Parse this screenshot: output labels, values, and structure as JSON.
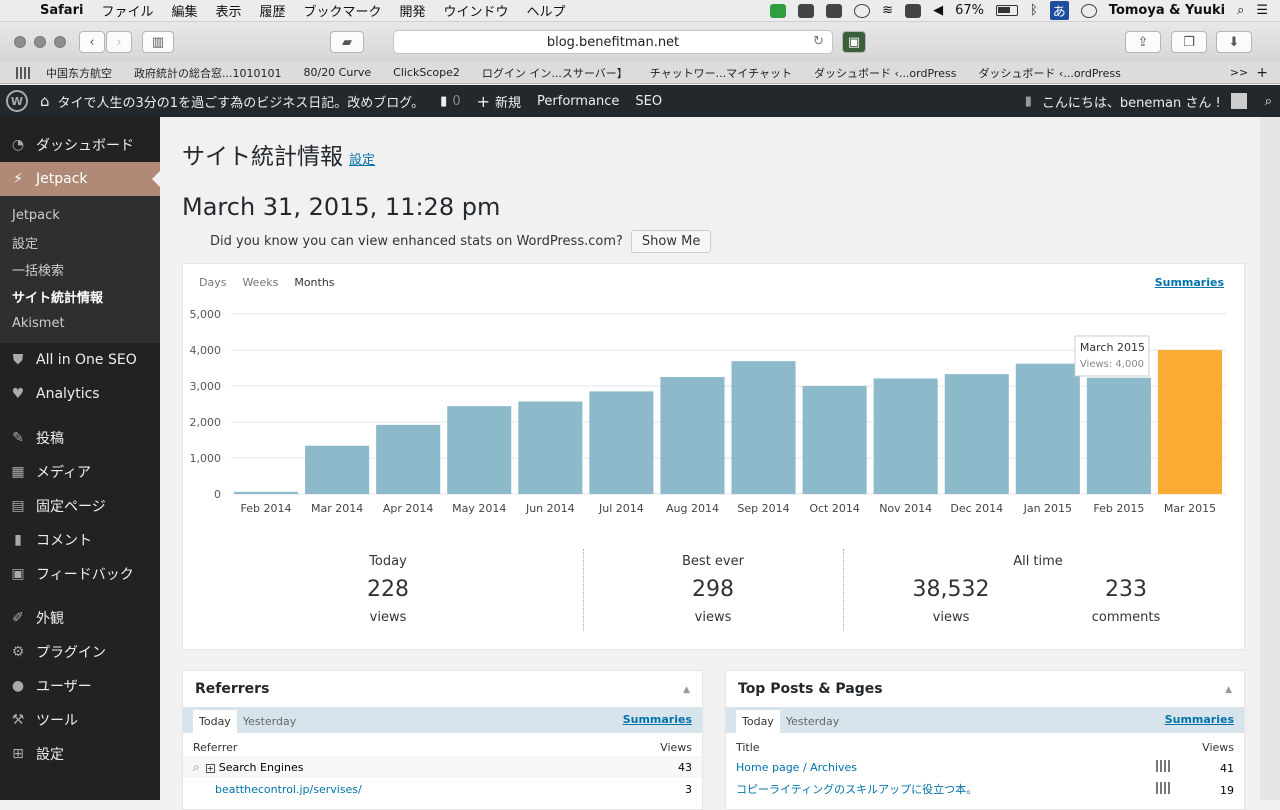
{
  "menubar": {
    "app": "Safari",
    "items": [
      "ファイル",
      "編集",
      "表示",
      "履歴",
      "ブックマーク",
      "開発",
      "ウインドウ",
      "ヘルプ"
    ],
    "battery": "67%",
    "input_method": "あ",
    "user": "Tomoya & Yuuki"
  },
  "browser": {
    "url": "blog.benefitman.net",
    "bookmarks": [
      "中国东方航空",
      "政府統計の総合窓...1010101",
      "80/20 Curve",
      "ClickScope2",
      "ログイン イン...スサーバー】",
      "チャットワー...マイチャット",
      "ダッシュボード ‹...ordPress",
      "ダッシュボード ‹...ordPress"
    ],
    "more": ">>"
  },
  "adminbar": {
    "site_title": "タイで人生の3分の1を過ごす為のビジネス日記。改めブログ。",
    "comments_count": "0",
    "new_label": "新規",
    "performance": "Performance",
    "seo": "SEO",
    "greeting": "こんにちは、beneman さん !"
  },
  "sidebar": {
    "dashboard": "ダッシュボード",
    "jetpack": "Jetpack",
    "submenu": [
      "Jetpack",
      "設定",
      "一括検索",
      "サイト統計情報",
      "Akismet"
    ],
    "items": [
      "All in One SEO",
      "Analytics",
      "投稿",
      "メディア",
      "固定ページ",
      "コメント",
      "フィードバック",
      "外観",
      "プラグイン",
      "ユーザー",
      "ツール",
      "設定"
    ]
  },
  "page": {
    "title": "サイト統計情報",
    "settings_link": "設定",
    "datetime": "March 31, 2015, 11:28 pm",
    "notice": "Did you know you can view enhanced stats on WordPress.com?",
    "show_me": "Show Me",
    "periods": [
      "Days",
      "Weeks",
      "Months"
    ],
    "summaries": "Summaries"
  },
  "chart_data": {
    "type": "bar",
    "categories": [
      "Feb 2014",
      "Mar 2014",
      "Apr 2014",
      "May 2014",
      "Jun 2014",
      "Jul 2014",
      "Aug 2014",
      "Sep 2014",
      "Oct 2014",
      "Nov 2014",
      "Dec 2014",
      "Jan 2015",
      "Feb 2015",
      "Mar 2015"
    ],
    "values": [
      60,
      1340,
      1920,
      2440,
      2570,
      2850,
      3250,
      3690,
      3000,
      3210,
      3330,
      3620,
      3230,
      4000
    ],
    "ylim": [
      0,
      5000
    ],
    "yticks": [
      "0",
      "1,000",
      "2,000",
      "3,000",
      "4,000",
      "5,000"
    ],
    "bar_color": "#8cbacb",
    "highlight_color": "#f9ab34",
    "highlight_index": 13,
    "grid": true,
    "tooltip": {
      "title": "March 2015",
      "value": "Views: 4,000"
    }
  },
  "stats": {
    "today": {
      "label": "Today",
      "value": "228",
      "unit": "views"
    },
    "best": {
      "label": "Best ever",
      "value": "298",
      "unit": "views"
    },
    "alltime": {
      "label": "All time",
      "views": "38,532",
      "views_unit": "views",
      "comments": "233",
      "comments_unit": "comments"
    }
  },
  "referrers": {
    "title": "Referrers",
    "tabs": [
      "Today",
      "Yesterday"
    ],
    "summaries": "Summaries",
    "col_left": "Referrer",
    "col_right": "Views",
    "rows": [
      {
        "name": "Search Engines",
        "views": "43"
      },
      {
        "name": "beatthecontrol.jp/servises/",
        "views": "3"
      }
    ]
  },
  "top_posts": {
    "title": "Top Posts & Pages",
    "tabs": [
      "Today",
      "Yesterday"
    ],
    "summaries": "Summaries",
    "col_left": "Title",
    "col_right": "Views",
    "rows": [
      {
        "name": "Home page / Archives",
        "views": "41"
      },
      {
        "name": "コピーライティングのスキルアップに役立つ本。",
        "views": "19"
      }
    ]
  }
}
